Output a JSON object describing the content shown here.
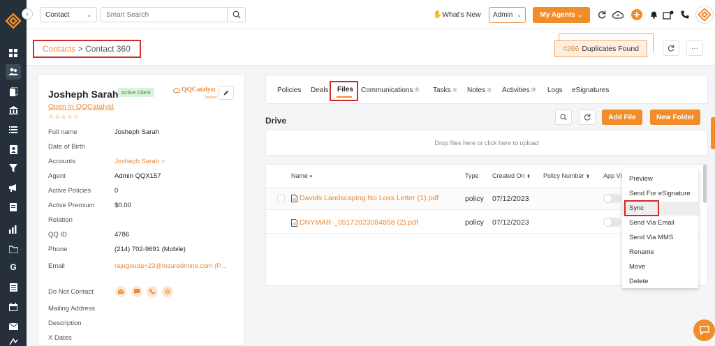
{
  "topbar": {
    "contact_select": "Contact",
    "search_placeholder": "Smart Search",
    "whats_new": "What's New",
    "admin_select": "Admin",
    "my_agents": "My Agents"
  },
  "header": {
    "breadcrumb_link": "Contacts",
    "breadcrumb_sep": " > ",
    "breadcrumb_current": "Contact 360",
    "duplicates_num": "#266",
    "duplicates_text": "Duplicates Found",
    "more_label": "···"
  },
  "contact": {
    "name": "Josheph Sarah",
    "status": "Active Client",
    "qq_logo": "QQCatalyst",
    "qq_logo_sub": "Insured",
    "open_link": "Open in QQCatalyst",
    "stars": "☆☆☆☆☆",
    "fields": [
      {
        "label": "Full name",
        "value": "Josheph Sarah"
      },
      {
        "label": "Date of Birth",
        "value": ""
      },
      {
        "label": "Accounts",
        "value": "Josheph Sarah >"
      },
      {
        "label": "Agent",
        "value": "Admin QQX157"
      },
      {
        "label": "Active Policies",
        "value": "0"
      },
      {
        "label": "Active Premium",
        "value": "$0.00"
      },
      {
        "label": "Relation",
        "value": ""
      },
      {
        "label": "QQ ID",
        "value": "4786"
      },
      {
        "label": "Phone",
        "value": "(214) 702-9691 (Mobile)"
      },
      {
        "label": "Email",
        "value": "rajugouda+23@insuredmine.com (P..."
      }
    ],
    "do_not_contact": "Do Not Contact",
    "mailing_address": "Mailing Address",
    "description": "Description",
    "x_dates": "X Dates"
  },
  "tabs": [
    {
      "label": "Policies",
      "count": ""
    },
    {
      "label": "Deals",
      "count": ""
    },
    {
      "label": "Files",
      "count": ""
    },
    {
      "label": "Communications",
      "count": "0"
    },
    {
      "label": "Tasks",
      "count": "1"
    },
    {
      "label": "Notes",
      "count": "1"
    },
    {
      "label": "Activities",
      "count": "0"
    },
    {
      "label": "Logs",
      "count": ""
    },
    {
      "label": "eSignatures",
      "count": ""
    }
  ],
  "drive": {
    "title": "Drive",
    "add_file": "Add File",
    "new_folder": "New Folder",
    "dropzone": "Drop files here or click here to upload",
    "columns": [
      "Name",
      "Type",
      "Created On",
      "Policy Number",
      "App Vi"
    ],
    "rows": [
      {
        "name": "Davids Landscaping No Loss Letter (1).pdf",
        "type": "policy",
        "created": "07/12/2023"
      },
      {
        "name": "DNYMAR-_05172023084858 (2).pdf",
        "type": "policy",
        "created": "07/12/2023"
      }
    ]
  },
  "context_menu": [
    "Preview",
    "Send For eSignature",
    "Sync",
    "Send Via Email",
    "Send Via MMS",
    "Rename",
    "Move",
    "Delete"
  ],
  "colors": {
    "accent": "#f28c28",
    "sidebar": "#25303b",
    "highlight": "#d62828"
  }
}
